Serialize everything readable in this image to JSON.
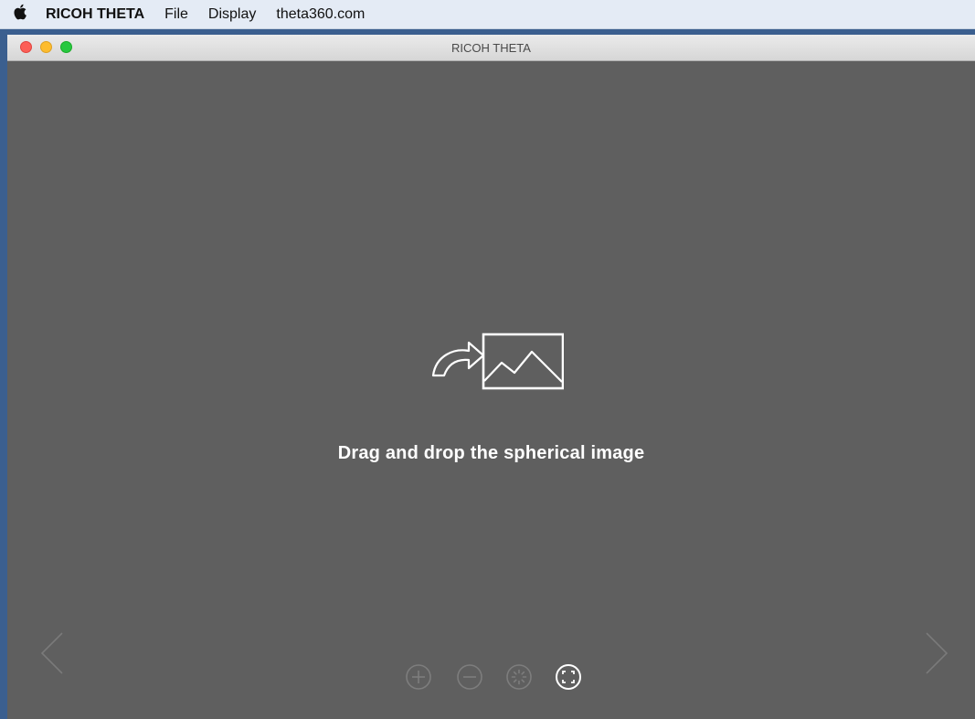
{
  "menubar": {
    "apple_icon": "apple-logo-icon",
    "app_name": "RICOH THETA",
    "items": [
      "File",
      "Display",
      "theta360.com"
    ]
  },
  "window": {
    "title": "RICOH THETA"
  },
  "dropzone": {
    "icon": "drag-drop-image-icon",
    "message": "Drag and drop the spherical image"
  },
  "controls": {
    "prev": "chevron-left-icon",
    "next": "chevron-right-icon",
    "zoom_in": "zoom-in-icon",
    "zoom_out": "zoom-out-icon",
    "auto_rotate": "auto-rotate-icon",
    "fit_view": "fit-view-icon"
  },
  "colors": {
    "canvas_bg": "#5f5f5f",
    "disabled_icon": "#7d7d7d",
    "active_icon": "#ffffff"
  }
}
